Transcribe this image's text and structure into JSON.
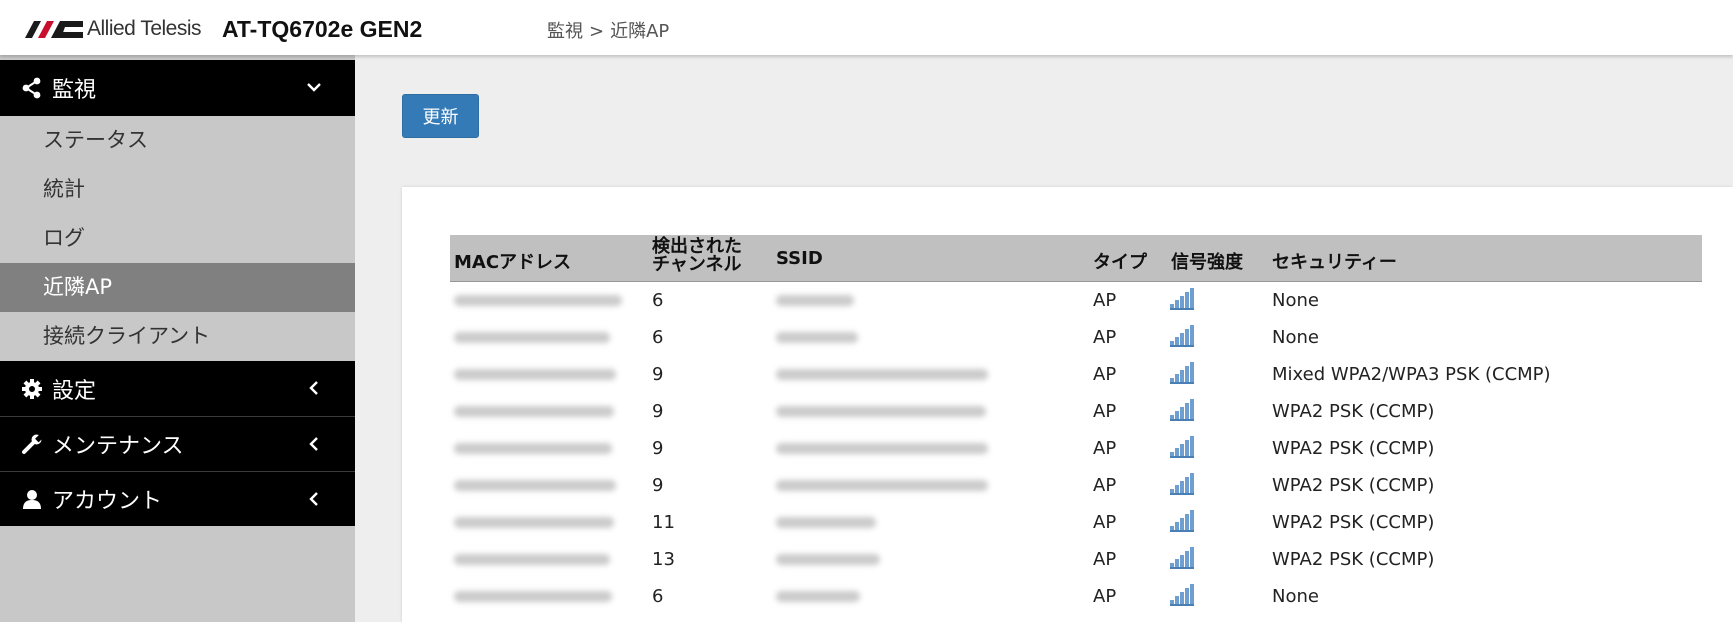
{
  "header": {
    "logo_text": "Allied Telesis",
    "product": "AT-TQ6702e GEN2",
    "breadcrumb": [
      "監視",
      "近隣AP"
    ],
    "breadcrumb_sep": ">"
  },
  "sidebar": {
    "groups": [
      {
        "label": "監視",
        "icon": "share-icon",
        "expanded": true,
        "items": [
          {
            "label": "ステータス",
            "active": false
          },
          {
            "label": "統計",
            "active": false
          },
          {
            "label": "ログ",
            "active": false
          },
          {
            "label": "近隣AP",
            "active": true
          },
          {
            "label": "接続クライアント",
            "active": false
          }
        ]
      },
      {
        "label": "設定",
        "icon": "gear-icon",
        "expanded": false
      },
      {
        "label": "メンテナンス",
        "icon": "wrench-icon",
        "expanded": false
      },
      {
        "label": "アカウント",
        "icon": "user-icon",
        "expanded": false
      }
    ]
  },
  "main": {
    "refresh_label": "更新",
    "table": {
      "headers": {
        "mac": "MACアドレス",
        "channel_line1": "検出された",
        "channel_line2": "チャンネル",
        "ssid": "SSID",
        "type": "タイプ",
        "signal": "信号強度",
        "security": "セキュリティー"
      },
      "rows": [
        {
          "channel": "6",
          "type": "AP",
          "signal_icon": "signal-bars-icon",
          "security": "None"
        },
        {
          "channel": "6",
          "type": "AP",
          "signal_icon": "signal-bars-icon",
          "security": "None"
        },
        {
          "channel": "9",
          "type": "AP",
          "signal_icon": "signal-bars-icon",
          "security": "Mixed WPA2/WPA3 PSK (CCMP)"
        },
        {
          "channel": "9",
          "type": "AP",
          "signal_icon": "signal-bars-icon",
          "security": "WPA2 PSK (CCMP)"
        },
        {
          "channel": "9",
          "type": "AP",
          "signal_icon": "signal-bars-icon",
          "security": "WPA2 PSK (CCMP)"
        },
        {
          "channel": "9",
          "type": "AP",
          "signal_icon": "signal-bars-icon",
          "security": "WPA2 PSK (CCMP)"
        },
        {
          "channel": "11",
          "type": "AP",
          "signal_icon": "signal-bars-icon",
          "security": "WPA2 PSK (CCMP)"
        },
        {
          "channel": "13",
          "type": "AP",
          "signal_icon": "signal-bars-icon",
          "security": "WPA2 PSK (CCMP)"
        },
        {
          "channel": "6",
          "type": "AP",
          "signal_icon": "signal-bars-icon",
          "security": "None"
        }
      ]
    }
  },
  "colors": {
    "primary_button": "#337ab7",
    "nav_group_bg": "#000000",
    "sidebar_bg": "#c8c8c8",
    "active_item_bg": "#808080",
    "table_header_bg": "#c0c0c0",
    "signal_bars": "#6f9fd0"
  }
}
